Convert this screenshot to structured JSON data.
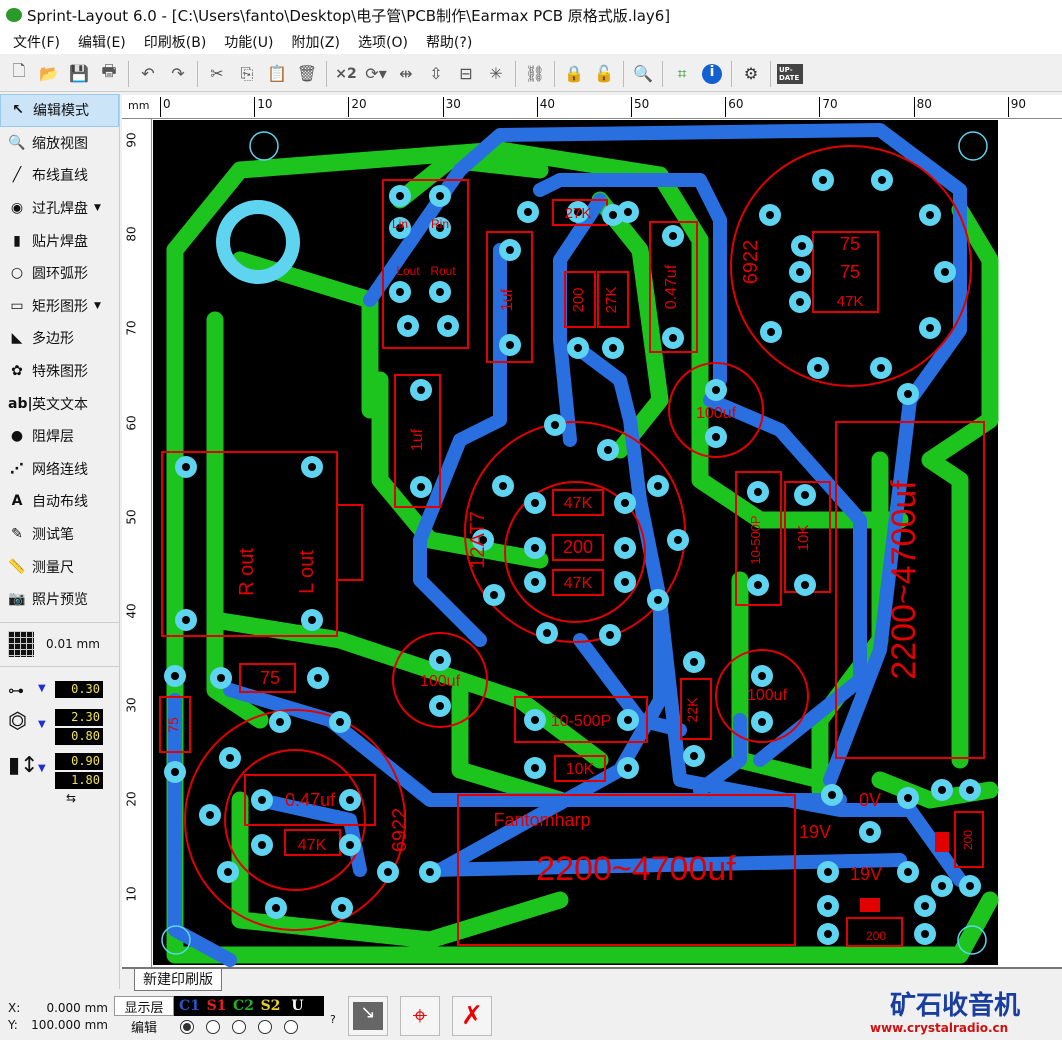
{
  "window": {
    "title": "Sprint-Layout 6.0 - [C:\\Users\\fanto\\Desktop\\电子管\\PCB制作\\Earmax PCB 原格式版.lay6]"
  },
  "menu": [
    "文件(F)",
    "编辑(E)",
    "印刷板(B)",
    "功能(U)",
    "附加(Z)",
    "选项(O)",
    "帮助(?)"
  ],
  "toolbar": {
    "x2_label": "×2",
    "update_label": "UP-DATE"
  },
  "tools": [
    {
      "label": "编辑模式",
      "icon": "↖",
      "name": "edit-mode"
    },
    {
      "label": "缩放视图",
      "icon": "🔍",
      "name": "zoom-view"
    },
    {
      "label": "布线直线",
      "icon": "╱",
      "name": "track"
    },
    {
      "label": "过孔焊盘",
      "icon": "◉",
      "name": "thru-pad",
      "dd": true
    },
    {
      "label": "贴片焊盘",
      "icon": "▮",
      "name": "smd-pad"
    },
    {
      "label": "圆环弧形",
      "icon": "○",
      "name": "circle"
    },
    {
      "label": "矩形图形",
      "icon": "▭",
      "name": "rectangle",
      "dd": true
    },
    {
      "label": "多边形",
      "icon": "◣",
      "name": "polygon"
    },
    {
      "label": "特殊图形",
      "icon": "✿",
      "name": "special-form"
    },
    {
      "label": "英文文本",
      "icon": "ab|",
      "name": "text"
    },
    {
      "label": "阻焊层",
      "icon": "●",
      "name": "solder-mask"
    },
    {
      "label": "网络连线",
      "icon": "⋰",
      "name": "connections"
    },
    {
      "label": "自动布线",
      "icon": "A",
      "name": "autoroute"
    },
    {
      "label": "测试笔",
      "icon": "✎",
      "name": "test"
    },
    {
      "label": "测量尺",
      "icon": "📏",
      "name": "measure"
    },
    {
      "label": "照片预览",
      "icon": "📷",
      "name": "photo-view"
    }
  ],
  "grid": {
    "value": "0.01 mm"
  },
  "params": {
    "track_width": "0.30",
    "pad_outer": "2.30",
    "pad_inner": "0.80",
    "smd_w": "0.90",
    "smd_h": "1.80"
  },
  "ruler": {
    "unit": "mm",
    "top": [
      "0",
      "10",
      "20",
      "30",
      "40",
      "50",
      "60",
      "70",
      "80",
      "90"
    ],
    "left": [
      "90",
      "80",
      "70",
      "60",
      "50",
      "40",
      "30",
      "20",
      "10"
    ]
  },
  "tab": {
    "label": "新建印刷版"
  },
  "status": {
    "x": "X:",
    "x_val": "0.000 mm",
    "y": "Y:",
    "y_val": "100.000 mm",
    "show_layer": "显示层",
    "edit": "编辑",
    "question": "?",
    "layers": [
      {
        "name": "C1",
        "color": "#2a54c8"
      },
      {
        "name": "S1",
        "color": "#e02020"
      },
      {
        "name": "C2",
        "color": "#21b021"
      },
      {
        "name": "S2",
        "color": "#e8d020"
      },
      {
        "name": "U",
        "color": "#ffffff"
      }
    ],
    "active_layer": 0
  },
  "watermark": {
    "title": "矿石收音机",
    "url": "www.crystalradio.cn"
  },
  "colors": {
    "board": "#000000",
    "top_copper": "#2a6fe0",
    "bottom_copper": "#1ec41e",
    "pad": "#5fd4f0",
    "silk": "#e00000"
  },
  "pcb_labels": {
    "lin": "Lin",
    "rin": "Rin",
    "lout": "Lout",
    "rout": "Rout",
    "r27k_a": "27K",
    "r200_a": "200",
    "r27k_b": "27K",
    "c047_a": "0.47uf",
    "c1uf_a": "1uf",
    "c1uf_b": "1uf",
    "tube1": "6922",
    "r75_a": "75",
    "r75_b": "75",
    "r47k_a": "47K",
    "c100_a": "100uf",
    "tube2": "12AT7",
    "r47k_b": "47K",
    "r200_b": "200",
    "r47k_c": "47K",
    "c10p_a": "10-500P",
    "r10k_a": "10K",
    "cap_big_a": "2200~4700uf",
    "rout_jack": "R out",
    "lout_jack": "L out",
    "c100_b": "100uf",
    "c10p_b": "10-500P",
    "r10k_b": "10K",
    "r22k": "22K",
    "c100_c": "100uf",
    "r75_c": "75",
    "r75_d": "75",
    "c047_b": "0.47uf",
    "r47k_d": "47K",
    "tube3": "6922",
    "brand": "Fantomharp",
    "cap_big_b": "2200~4700uf",
    "ov": "0V",
    "v19_a": "19V",
    "v19_b": "19V",
    "r200_c": "200",
    "r200_d": "200"
  }
}
